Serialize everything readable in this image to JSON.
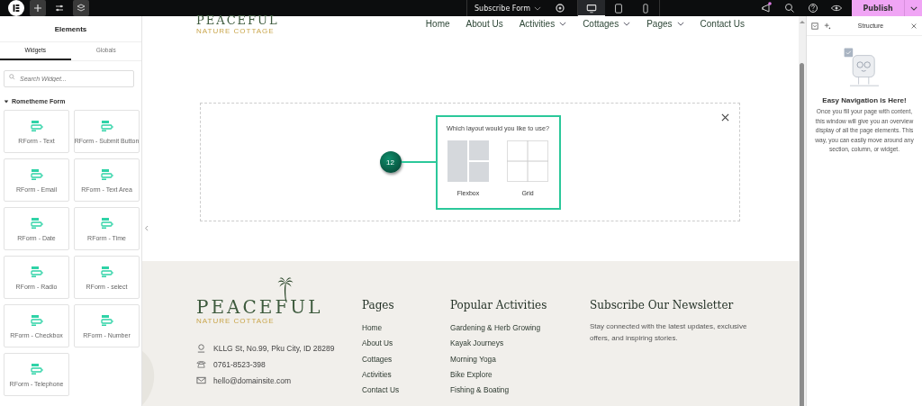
{
  "topbar": {
    "document": "Subscribe Form",
    "devices": [
      {
        "kind": "desktop",
        "selected": true
      },
      {
        "kind": "tablet",
        "selected": false
      },
      {
        "kind": "mobile",
        "selected": false
      }
    ],
    "publish": "Publish"
  },
  "elements_panel": {
    "title": "Elements",
    "tabs": [
      {
        "label": "Widgets",
        "selected": true
      },
      {
        "label": "Globals",
        "selected": false
      }
    ],
    "search": {
      "placeholder": "Search Widget..."
    },
    "category": {
      "label": "Rometheme Form",
      "expanded": true
    },
    "widgets": [
      "RForm - Text",
      "RForm - Submit Button",
      "RForm - Email",
      "RForm - Text Area",
      "RForm - Date",
      "RForm - Time",
      "RForm - Radio",
      "RForm - select",
      "RForm - Checkbox",
      "RForm - Number",
      "RForm - Telephone"
    ]
  },
  "site": {
    "logo": {
      "name": "PEACEFUL",
      "tagline": "NATURE COTTAGE"
    },
    "nav": [
      {
        "label": "Home",
        "dropdown": false
      },
      {
        "label": "About Us",
        "dropdown": false
      },
      {
        "label": "Activities",
        "dropdown": true
      },
      {
        "label": "Cottages",
        "dropdown": true
      },
      {
        "label": "Pages",
        "dropdown": true
      },
      {
        "label": "Contact Us",
        "dropdown": false
      }
    ],
    "layout_prompt": {
      "step": "12",
      "question": "Which layout would you like to use?",
      "options": [
        {
          "kind": "flexbox",
          "label": "Flexbox"
        },
        {
          "kind": "grid",
          "label": "Grid"
        }
      ]
    },
    "footer": {
      "logo": {
        "name": "PEACEFUL",
        "tagline": "NATURE COTTAGE"
      },
      "contacts": [
        {
          "kind": "address",
          "text": "KLLG St, No.99, Pku City, ID 28289"
        },
        {
          "kind": "phone",
          "text": "0761-8523-398"
        },
        {
          "kind": "email",
          "text": "hello@domainsite.com"
        }
      ],
      "pages": {
        "title": "Pages",
        "links": [
          "Home",
          "About Us",
          "Cottages",
          "Activities",
          "Contact Us"
        ]
      },
      "activities": {
        "title": "Popular Activities",
        "links": [
          "Gardening & Herb Growing",
          "Kayak Journeys",
          "Morning Yoga",
          "Bike Explore",
          "Fishing & Boating"
        ]
      },
      "newsletter": {
        "title": "Subscribe Our Newsletter",
        "text": "Stay connected with the latest updates, exclusive offers, and inspiring stories."
      }
    }
  },
  "structure_panel": {
    "title": "Structure",
    "heading": "Easy Navigation is Here!",
    "text": "Once you fill your page with content, this window will give you an overview display of all the page elements. This way, you can easily move around any section, column, or widget."
  }
}
